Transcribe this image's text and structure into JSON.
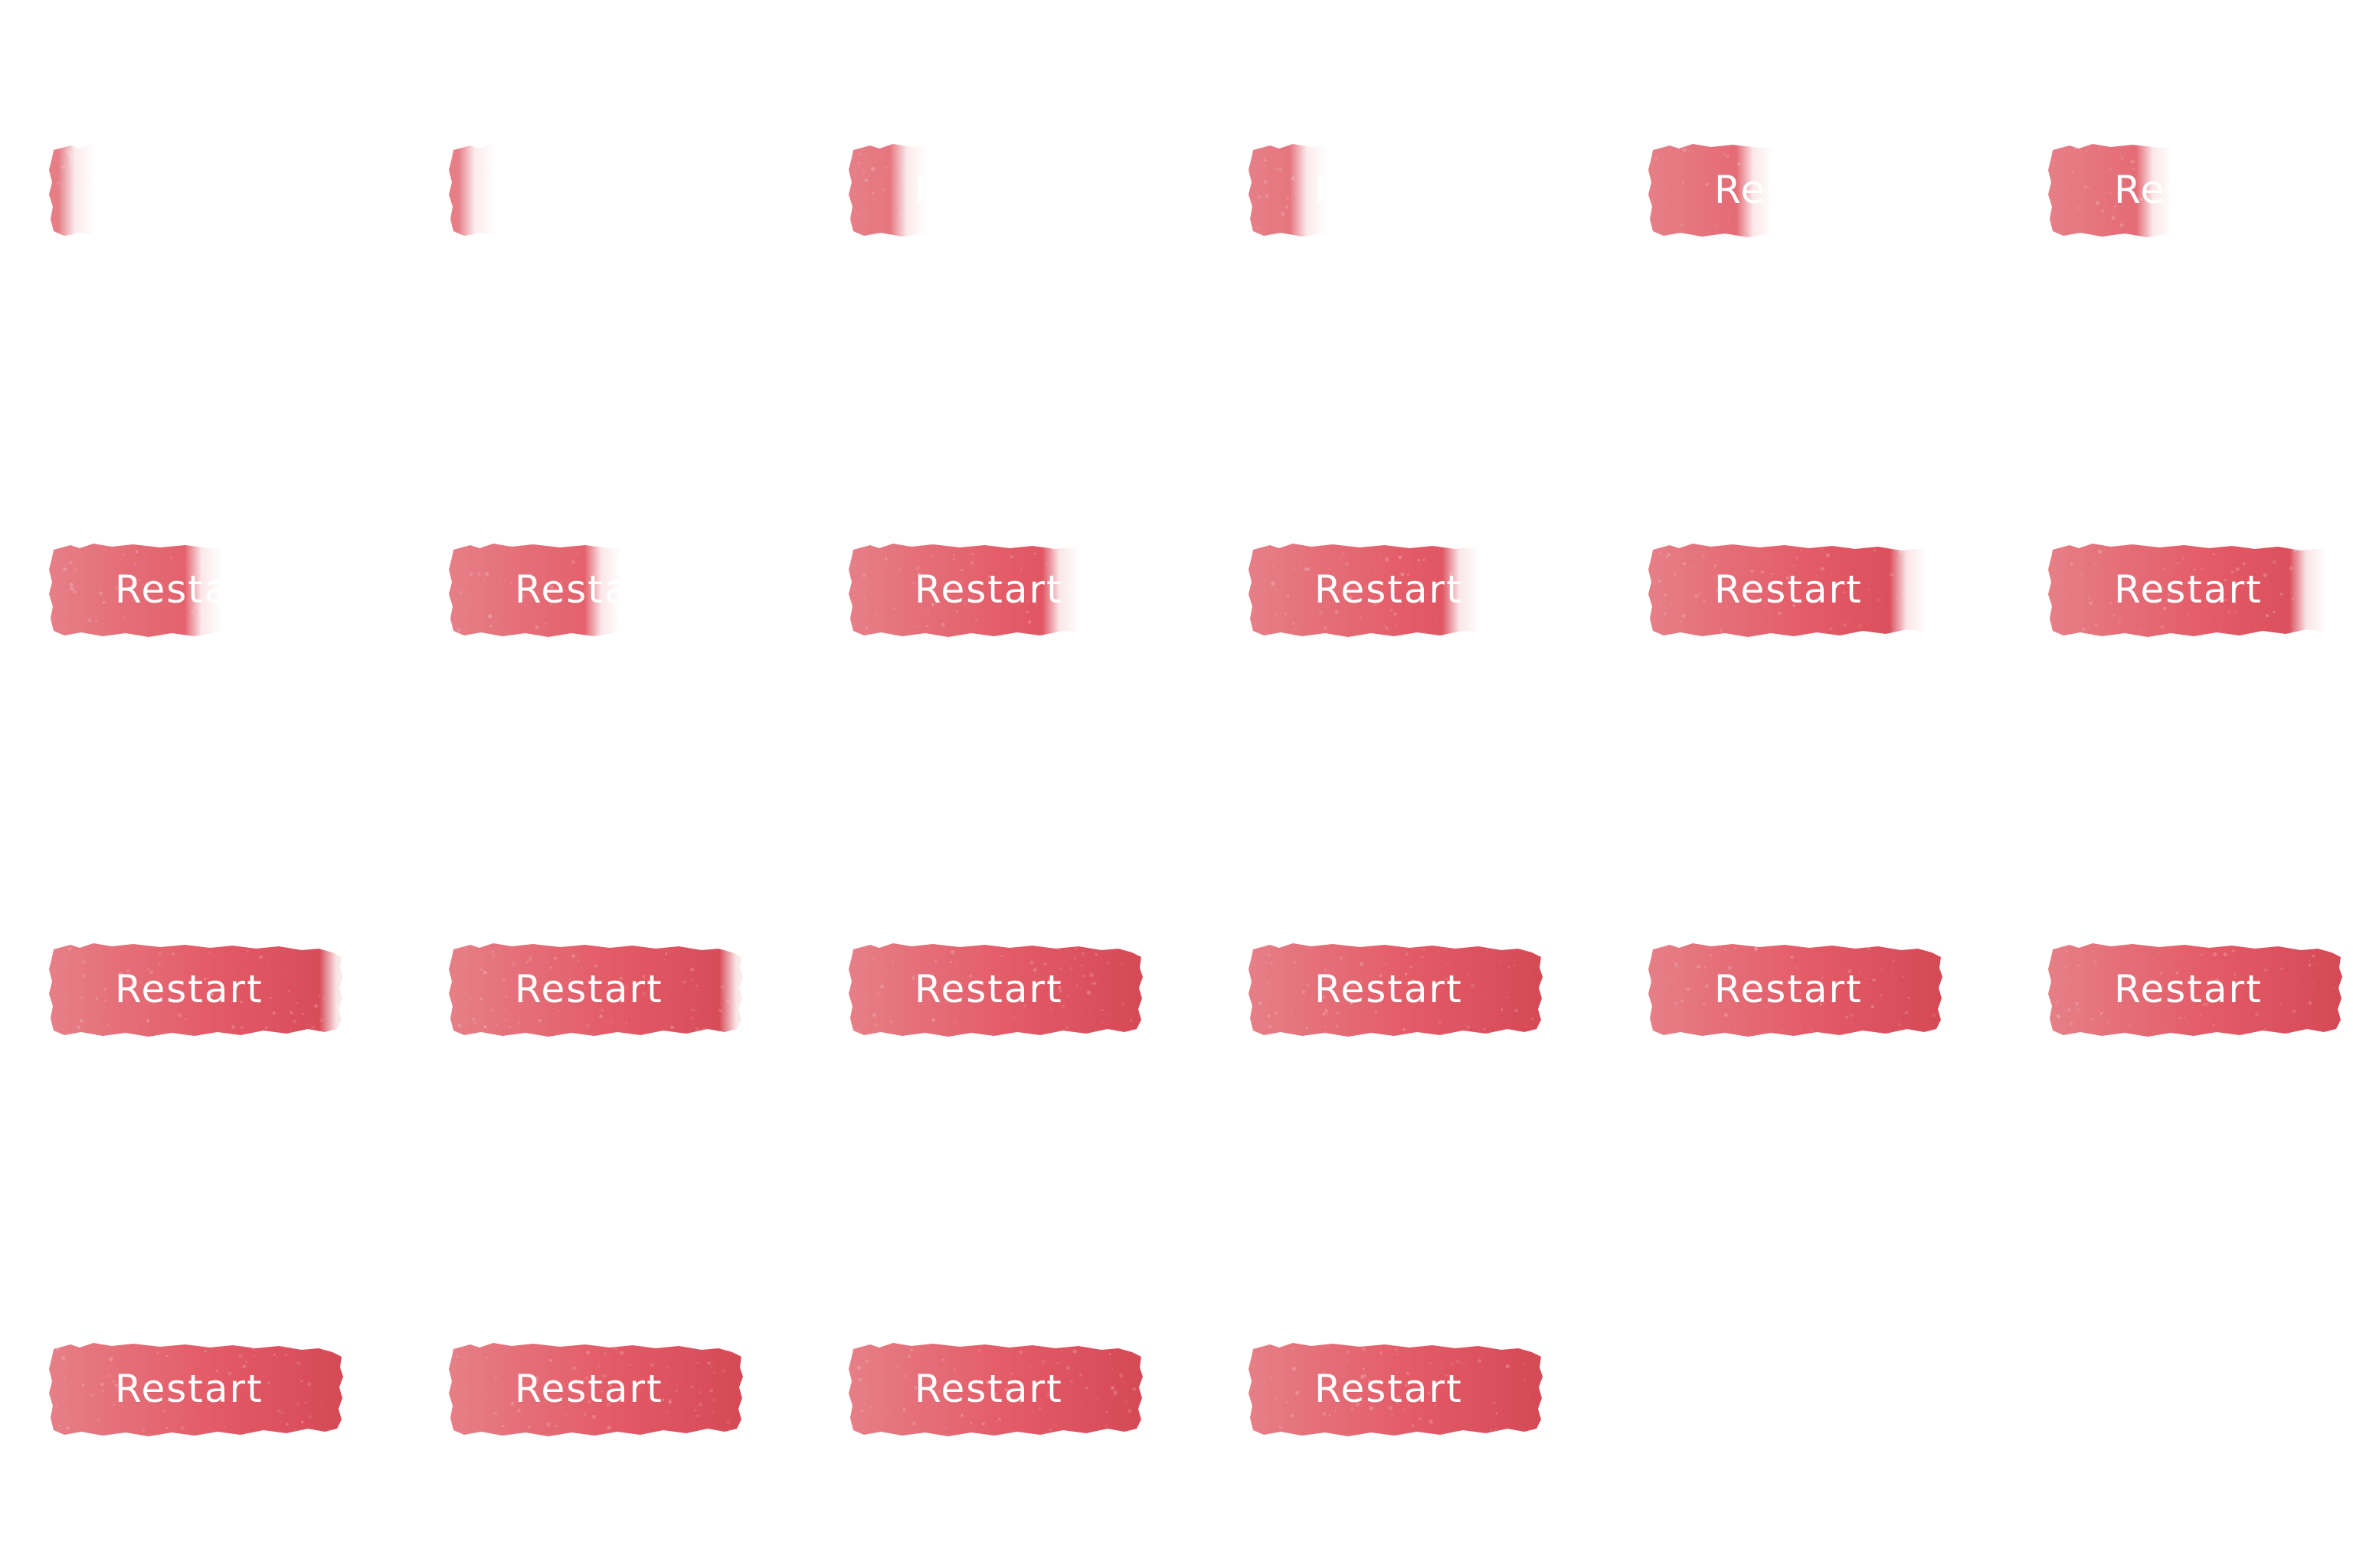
{
  "sprite_sheet": {
    "frame_count": 22,
    "button": {
      "label": "Restart",
      "fill_colors": {
        "light": "#e67f87",
        "base": "#e35b67",
        "deep": "#d54955"
      }
    },
    "frames": [
      {
        "reveal": 0.03
      },
      {
        "reveal": 0.03
      },
      {
        "reveal": 0.14
      },
      {
        "reveal": 0.14
      },
      {
        "reveal": 0.3
      },
      {
        "reveal": 0.3
      },
      {
        "reveal": 0.46
      },
      {
        "reveal": 0.46
      },
      {
        "reveal": 0.66
      },
      {
        "reveal": 0.66
      },
      {
        "reveal": 0.82
      },
      {
        "reveal": 0.82
      },
      {
        "reveal": 0.92
      },
      {
        "reveal": 0.92
      },
      {
        "reveal": 1.0
      },
      {
        "reveal": 1.0
      },
      {
        "reveal": 1.0
      },
      {
        "reveal": 1.0
      },
      {
        "reveal": 1.0
      },
      {
        "reveal": 1.0
      },
      {
        "reveal": 1.0
      },
      {
        "reveal": 1.0
      }
    ]
  }
}
